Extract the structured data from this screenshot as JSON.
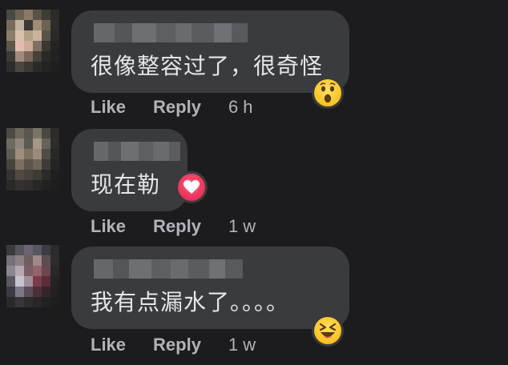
{
  "comments": [
    {
      "text": "很像整容过了，很奇怪",
      "reaction": "wow-face-icon",
      "like_label": "Like",
      "reply_label": "Reply",
      "time": "6 h"
    },
    {
      "text": "现在勒",
      "reaction": "love-heart-icon",
      "like_label": "Like",
      "reply_label": "Reply",
      "time": "1 w"
    },
    {
      "text": "我有点漏水了。。。。",
      "reaction": "laughing-face-icon",
      "like_label": "Like",
      "reply_label": "Reply",
      "time": "1 w"
    }
  ],
  "colors": {
    "background": "#1c1c1e",
    "bubble": "#3a3b3c",
    "comment_text": "#e4e6eb",
    "meta_text": "#b0b3b8"
  }
}
